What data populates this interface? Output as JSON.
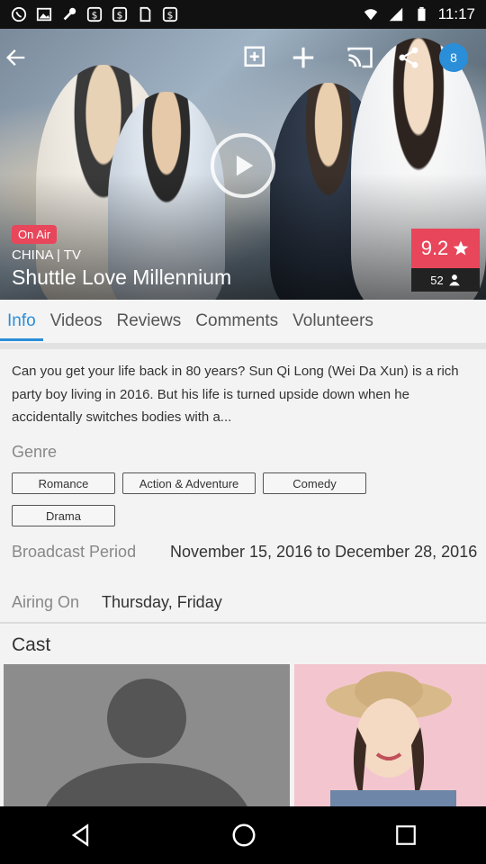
{
  "status_bar": {
    "time": "11:17",
    "icons": [
      "whatsapp-icon",
      "photo-icon",
      "wrench-icon",
      "money-icon",
      "money-icon",
      "sim-icon",
      "money-icon",
      "wifi-icon",
      "signal-icon",
      "battery-icon"
    ]
  },
  "hero": {
    "badge_count": "8",
    "status_badge": "On Air",
    "country_type": "CHINA | TV",
    "title": "Shuttle Love Millennium",
    "rating": "9.2",
    "votes": "52"
  },
  "tabs": [
    "Info",
    "Videos",
    "Reviews",
    "Comments",
    "Volunteers"
  ],
  "info": {
    "description": "Can you get your life back in 80 years? Sun Qi Long (Wei Da Xun) is a rich party boy living in 2016. But his life is turned upside down when he accidentally switches bodies with a...",
    "genre_label": "Genre",
    "genres": [
      "Romance",
      "Action & Adventure",
      "Comedy",
      "Drama"
    ],
    "broadcast_label": "Broadcast Period",
    "broadcast_value": "November 15, 2016 to December 28, 2016",
    "airing_label": "Airing On",
    "airing_value": "Thursday, Friday",
    "cast_label": "Cast"
  },
  "colors": {
    "accent": "#2a8ed8",
    "on_air": "#e8465a",
    "rating_bg": "#e8465a"
  }
}
